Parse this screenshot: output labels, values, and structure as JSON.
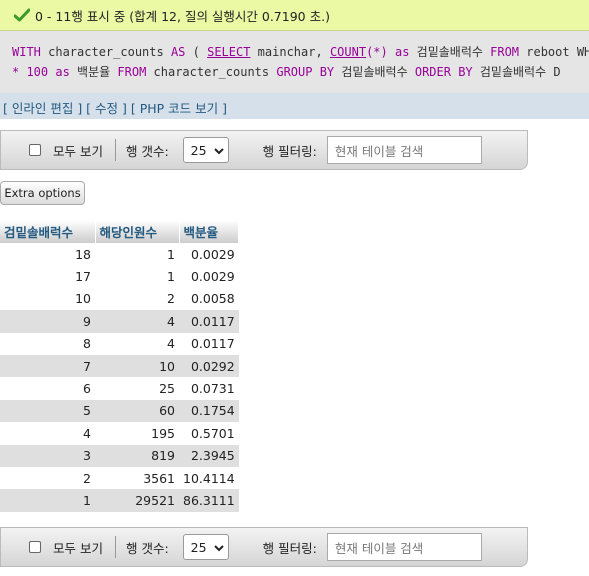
{
  "status": {
    "message": "0 - 11행 표시 중 (합계 12, 질의 실행시간 0.7190 초.)",
    "icon": "check-icon"
  },
  "sql": {
    "line1": [
      {
        "t": "WITH",
        "c": "kw"
      },
      {
        "t": " character_counts ",
        "c": "sp"
      },
      {
        "t": "AS",
        "c": "kw"
      },
      {
        "t": " ( ",
        "c": "sp"
      },
      {
        "t": "SELECT",
        "c": "fn"
      },
      {
        "t": " mainchar, ",
        "c": "sp"
      },
      {
        "t": "COUNT",
        "c": "fn"
      },
      {
        "t": "(*)",
        "c": "op"
      },
      {
        "t": " as ",
        "c": "kw"
      },
      {
        "t": "검밑솔배럭수 ",
        "c": "sp"
      },
      {
        "t": "FROM",
        "c": "kw"
      },
      {
        "t": " reboot WH",
        "c": "sp"
      }
    ],
    "line2": [
      {
        "t": "* 100 ",
        "c": "num"
      },
      {
        "t": "as",
        "c": "kw"
      },
      {
        "t": " 백분율 ",
        "c": "sp"
      },
      {
        "t": "FROM",
        "c": "kw"
      },
      {
        "t": " character_counts ",
        "c": "sp"
      },
      {
        "t": "GROUP BY",
        "c": "kw"
      },
      {
        "t": " 검밑솔배럭수 ",
        "c": "sp"
      },
      {
        "t": "ORDER BY",
        "c": "kw"
      },
      {
        "t": " 검밑솔배럭수 D",
        "c": "sp"
      }
    ]
  },
  "toolbar": {
    "bracket_open": "[ ",
    "inline_edit": "인라인 편집",
    "bracket_mid1": " ] [ ",
    "edit": "수정",
    "bracket_mid2": " ] [ ",
    "php_code": "PHP 코드 보기",
    "bracket_close": " ]"
  },
  "nav": {
    "show_all": "모두 보기",
    "row_count_label": "행 갯수:",
    "row_count_value": "25",
    "row_filter_label": "행 필터링:",
    "filter_placeholder": "현재 테이블 검색"
  },
  "extra_options": "Extra options",
  "table": {
    "headers": [
      "검밑솔배럭수",
      "해당인원수",
      "백분율"
    ],
    "rows": [
      [
        "18",
        "1",
        "0.0029"
      ],
      [
        "17",
        "1",
        "0.0029"
      ],
      [
        "10",
        "2",
        "0.0058"
      ],
      [
        "9",
        "4",
        "0.0117"
      ],
      [
        "8",
        "4",
        "0.0117"
      ],
      [
        "7",
        "10",
        "0.0292"
      ],
      [
        "6",
        "25",
        "0.0731"
      ],
      [
        "5",
        "60",
        "0.1754"
      ],
      [
        "4",
        "195",
        "0.5701"
      ],
      [
        "3",
        "819",
        "2.3945"
      ],
      [
        "2",
        "3561",
        "10.4114"
      ],
      [
        "1",
        "29521",
        "86.3111"
      ]
    ]
  },
  "colors": {
    "success_bg": "#ebf8a4",
    "link": "#235a81",
    "sql_keyword": "#990099"
  }
}
